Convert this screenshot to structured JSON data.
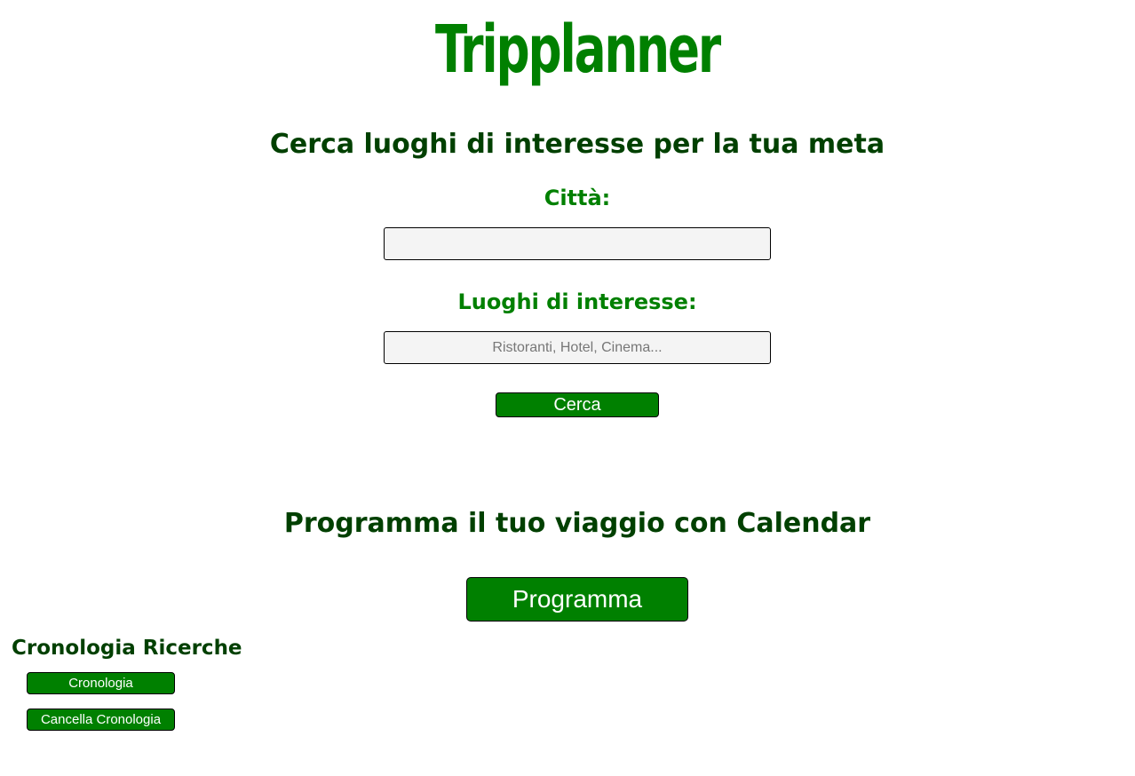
{
  "app": {
    "logo_text": "Tripplanner"
  },
  "search_section": {
    "title": "Cerca luoghi di interesse per la tua meta",
    "city_label": "Città:",
    "city_value": "",
    "places_label": "Luoghi di interesse:",
    "places_value": "",
    "places_placeholder": "Ristoranti, Hotel, Cinema...",
    "search_button": "Cerca"
  },
  "calendar_section": {
    "title": "Programma il tuo viaggio con Calendar",
    "schedule_button": "Programma"
  },
  "history_section": {
    "title": "Cronologia Ricerche",
    "history_button": "Cronologia",
    "clear_button": "Cancella Cronologia"
  },
  "colors": {
    "brand_green": "#008000",
    "heading_dark_green": "#004000",
    "input_background": "#f4f4f4"
  }
}
